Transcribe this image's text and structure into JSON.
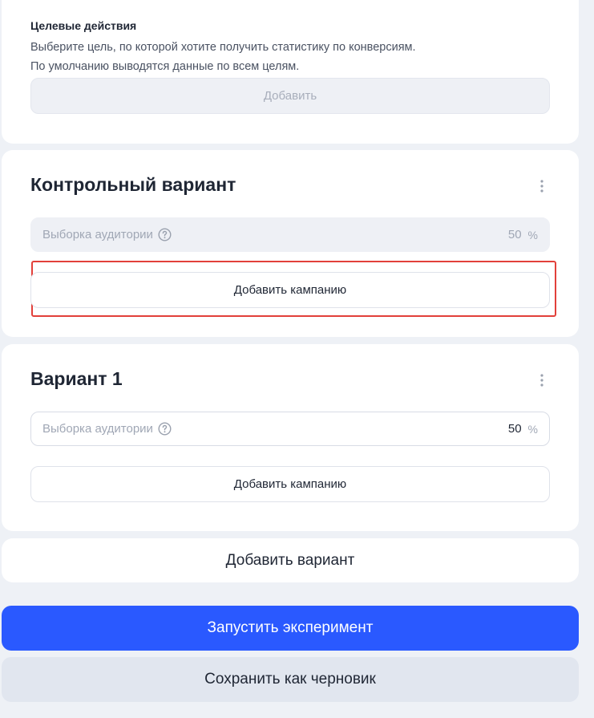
{
  "goals": {
    "title": "Целевые действия",
    "description_line1": "Выберите цель, по которой хотите получить статистику по конверсиям.",
    "description_line2": "По умолчанию выводятся данные по всем целям.",
    "add_label": "Добавить"
  },
  "control_variant": {
    "title": "Контрольный вариант",
    "audience_label": "Выборка аудитории",
    "audience_value": "50",
    "audience_unit": "%",
    "add_campaign_label": "Добавить кампанию"
  },
  "variant_1": {
    "title": "Вариант 1",
    "audience_label": "Выборка аудитории",
    "audience_value": "50",
    "audience_unit": "%",
    "add_campaign_label": "Добавить кампанию"
  },
  "add_variant_label": "Добавить вариант",
  "actions": {
    "launch_label": "Запустить эксперимент",
    "save_draft_label": "Сохранить как черновик"
  },
  "colors": {
    "primary": "#2a59ff",
    "highlight": "#e2403a",
    "background": "#eef1f6"
  },
  "icons": [
    "help-circle-icon",
    "more-vertical-icon"
  ]
}
